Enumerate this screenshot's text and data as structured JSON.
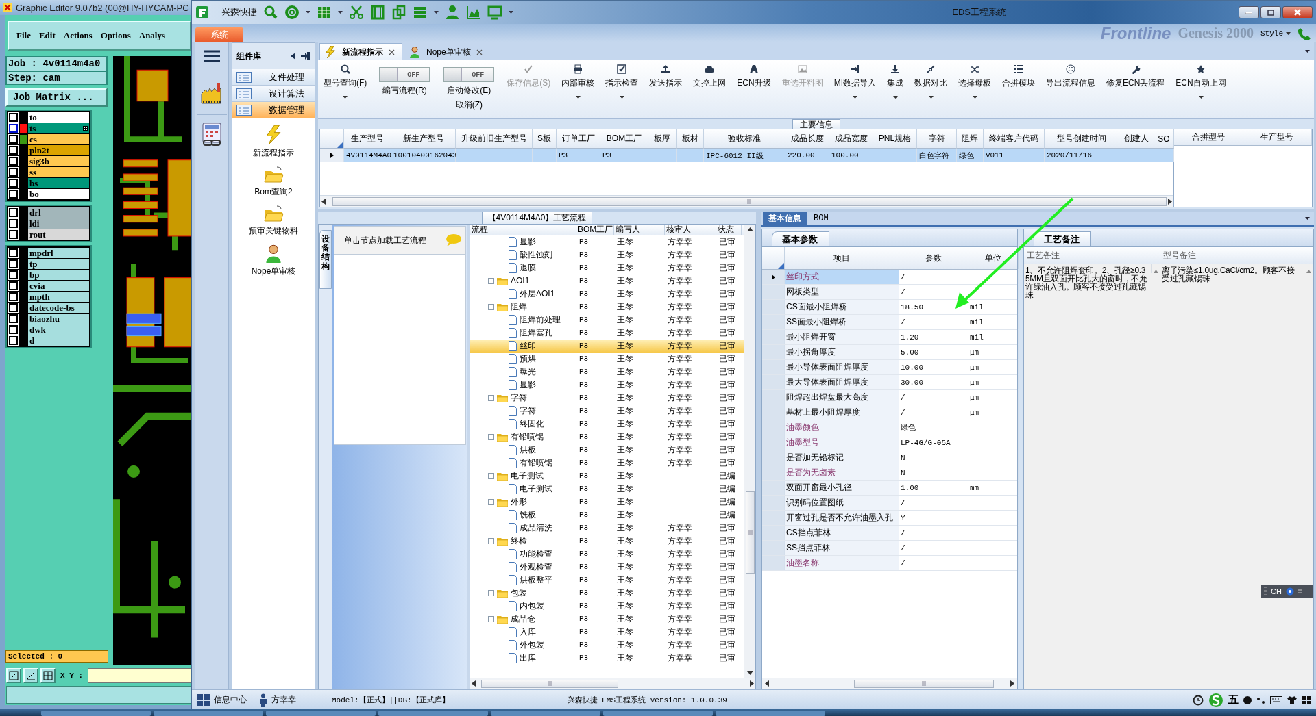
{
  "editor": {
    "title": "Graphic Editor 9.07b2 (00@HY-HYCAM-PC",
    "menu": [
      "File",
      "Edit",
      "Actions",
      "Options",
      "Analys"
    ],
    "job": "Job : 4v0114m4a0",
    "step": "Step: cam",
    "matrix_button": "Job Matrix ...",
    "layer_groups": [
      {
        "layers": [
          {
            "name": "to",
            "color": "#ffffff",
            "selected": false
          },
          {
            "name": "ts",
            "color": "#00987a",
            "swatch": {
              "color": "#ff1010"
            },
            "selected": true
          },
          {
            "name": "cs",
            "color": "#ffc850",
            "swatch": {
              "color": "#3c9a14"
            },
            "selected": false
          },
          {
            "name": "pln2t",
            "color": "#dca400",
            "selected": false
          },
          {
            "name": "sig3b",
            "color": "#ffc850",
            "selected": false
          },
          {
            "name": "ss",
            "color": "#ffc850",
            "selected": false
          },
          {
            "name": "bs",
            "color": "#00987a",
            "selected": false
          },
          {
            "name": "bo",
            "color": "#ffffff",
            "selected": false
          }
        ]
      },
      {
        "layers": [
          {
            "name": "drl",
            "color": "#a2b6ba",
            "selected": false
          },
          {
            "name": "ldi",
            "color": "#a2b6ba",
            "selected": false
          },
          {
            "name": "rout",
            "color": "#d8d8d8",
            "selected": false
          }
        ]
      },
      {
        "layers": [
          {
            "name": "mpdrl",
            "color": "#a6dede",
            "selected": false
          },
          {
            "name": "tp",
            "color": "#a6dede",
            "selected": false
          },
          {
            "name": "bp",
            "color": "#a6dede",
            "selected": false
          },
          {
            "name": "cvia",
            "color": "#a6dede",
            "selected": false
          },
          {
            "name": "mpth",
            "color": "#a6dede",
            "selected": false
          },
          {
            "name": "datecode-bs",
            "color": "#a6dede",
            "selected": false
          },
          {
            "name": "biaozhu",
            "color": "#a6dede",
            "selected": false
          },
          {
            "name": "dwk",
            "color": "#a6dede",
            "selected": false
          },
          {
            "name": "d",
            "color": "#a6dede",
            "selected": false
          }
        ]
      }
    ],
    "selected_count": "Selected : 0",
    "xy_label": "X Y :"
  },
  "app": {
    "title": "EDS工程系统",
    "quick_access": "兴森快捷",
    "ribbon_tab": "系统",
    "banner": [
      "Frontline",
      "Genesis 2000"
    ],
    "style_menu": "Style",
    "components": {
      "title": "组件库",
      "categories": [
        {
          "label": "文件处理",
          "selected": false
        },
        {
          "label": "设计算法",
          "selected": false
        },
        {
          "label": "数据管理",
          "selected": true
        }
      ],
      "tools": [
        "新流程指示",
        "Bom查询2",
        "预审关键物料",
        "Nope单审核"
      ]
    },
    "doc_tabs": [
      {
        "label": "新流程指示",
        "selected": true
      },
      {
        "label": "Nope单审核",
        "selected": false
      }
    ],
    "toolbar": [
      {
        "kind": "button",
        "label": "型号查询(F)",
        "dropdown": true,
        "disabled": false
      },
      {
        "kind": "toggle",
        "label": "编写流程(R)",
        "state_text": "OFF",
        "on": false
      },
      {
        "kind": "toggle",
        "label": "启动修改(E)",
        "sublabel": "取消(Z)",
        "state_text": "OFF",
        "on": false
      },
      {
        "kind": "button",
        "label": "保存信息(S)",
        "dropdown": false,
        "disabled": true
      },
      {
        "kind": "button",
        "label": "内部审核",
        "dropdown": true,
        "disabled": false
      },
      {
        "kind": "button",
        "label": "指示检查",
        "dropdown": true,
        "disabled": false
      },
      {
        "kind": "button",
        "label": "发送指示",
        "dropdown": false,
        "disabled": false
      },
      {
        "kind": "button",
        "label": "文控上网",
        "dropdown": false,
        "disabled": false
      },
      {
        "kind": "button",
        "label": "ECN升级",
        "dropdown": false,
        "disabled": false
      },
      {
        "kind": "button",
        "label": "重选开料图",
        "dropdown": false,
        "disabled": true
      },
      {
        "kind": "button",
        "label": "MI数据导入",
        "dropdown": true,
        "disabled": false
      },
      {
        "kind": "button",
        "label": "集成",
        "dropdown": true,
        "disabled": false
      },
      {
        "kind": "button",
        "label": "数据对比",
        "dropdown": true,
        "disabled": false
      },
      {
        "kind": "button",
        "label": "选择母板",
        "dropdown": true,
        "disabled": false
      },
      {
        "kind": "button",
        "label": "合拼模块",
        "dropdown": false,
        "disabled": false
      },
      {
        "kind": "button",
        "label": "导出流程信息",
        "dropdown": false,
        "disabled": false
      },
      {
        "kind": "button",
        "label": "修复ECN丢流程",
        "dropdown": false,
        "disabled": false
      },
      {
        "kind": "button",
        "label": "ECN自动上网",
        "dropdown": true,
        "disabled": false
      }
    ],
    "main_info": {
      "title": "主要信息",
      "columns": [
        "生产型号",
        "新生产型号",
        "升级前旧生产型号",
        "S板",
        "订单工厂",
        "BOM工厂",
        "板厚",
        "板材",
        "验收标准",
        "成品长度",
        "成品宽度",
        "PNL规格",
        "字符",
        "阻焊",
        "终端客户代码",
        "型号创建时间",
        "创建人",
        "SO"
      ],
      "rows": [
        {
          "selected": true,
          "cells": [
            "4V0114M4A0",
            "10010400162043",
            null,
            null,
            "P3",
            "P3",
            null,
            null,
            "IPC-6012 II级",
            "220.00",
            "100.00",
            null,
            "白色字符",
            "绿色",
            "V011",
            "2020/11/16",
            null,
            null
          ]
        }
      ],
      "side_columns": [
        "合拼型号",
        "生产型号"
      ]
    },
    "flow": {
      "title": "【4V0114M4A0】工艺流程",
      "side_tab": "设备结构",
      "hint": "单击节点加载工艺流程",
      "columns": [
        "流程",
        "BOM工厂",
        "编写人",
        "核审人",
        "状态"
      ],
      "nodes": [
        {
          "kind": "step",
          "label": "显影",
          "bom": "P3",
          "writer": "王琴",
          "reviewer": "方幸幸",
          "status": "已审",
          "selected": false
        },
        {
          "kind": "step",
          "label": "酸性蚀刻",
          "bom": "P3",
          "writer": "王琴",
          "reviewer": "方幸幸",
          "status": "已审",
          "selected": false
        },
        {
          "kind": "step",
          "label": "退膜",
          "bom": "P3",
          "writer": "王琴",
          "reviewer": "方幸幸",
          "status": "已审",
          "selected": false
        },
        {
          "kind": "group",
          "label": "AOI1",
          "bom": "P3",
          "writer": "王琴",
          "reviewer": "方幸幸",
          "status": "已审",
          "selected": false,
          "expanded": true,
          "children": [
            {
              "kind": "step",
              "label": "外层AOI1",
              "bom": "P3",
              "writer": "王琴",
              "reviewer": "方幸幸",
              "status": "已审",
              "selected": false
            }
          ]
        },
        {
          "kind": "group",
          "label": "阻焊",
          "bom": "P3",
          "writer": "王琴",
          "reviewer": "方幸幸",
          "status": "已审",
          "selected": false,
          "expanded": true,
          "children": [
            {
              "kind": "step",
              "label": "阻焊前处理",
              "bom": "P3",
              "writer": "王琴",
              "reviewer": "方幸幸",
              "status": "已审",
              "selected": false
            },
            {
              "kind": "step",
              "label": "阻焊塞孔",
              "bom": "P3",
              "writer": "王琴",
              "reviewer": "方幸幸",
              "status": "已审",
              "selected": false
            },
            {
              "kind": "step",
              "label": "丝印",
              "bom": "P3",
              "writer": "王琴",
              "reviewer": "方幸幸",
              "status": "已审",
              "selected": true
            },
            {
              "kind": "step",
              "label": "预烘",
              "bom": "P3",
              "writer": "王琴",
              "reviewer": "方幸幸",
              "status": "已审",
              "selected": false
            },
            {
              "kind": "step",
              "label": "曝光",
              "bom": "P3",
              "writer": "王琴",
              "reviewer": "方幸幸",
              "status": "已审",
              "selected": false
            },
            {
              "kind": "step",
              "label": "显影",
              "bom": "P3",
              "writer": "王琴",
              "reviewer": "方幸幸",
              "status": "已审",
              "selected": false
            }
          ]
        },
        {
          "kind": "group",
          "label": "字符",
          "bom": "P3",
          "writer": "王琴",
          "reviewer": "方幸幸",
          "status": "已审",
          "selected": false,
          "expanded": true,
          "children": [
            {
              "kind": "step",
              "label": "字符",
              "bom": "P3",
              "writer": "王琴",
              "reviewer": "方幸幸",
              "status": "已审",
              "selected": false
            },
            {
              "kind": "step",
              "label": "终固化",
              "bom": "P3",
              "writer": "王琴",
              "reviewer": "方幸幸",
              "status": "已审",
              "selected": false
            }
          ]
        },
        {
          "kind": "group",
          "label": "有铅喷锡",
          "bom": "P3",
          "writer": "王琴",
          "reviewer": "方幸幸",
          "status": "已审",
          "selected": false,
          "expanded": true,
          "children": [
            {
              "kind": "step",
              "label": "烘板",
              "bom": "P3",
              "writer": "王琴",
              "reviewer": "方幸幸",
              "status": "已审",
              "selected": false
            },
            {
              "kind": "step",
              "label": "有铅喷锡",
              "bom": "P3",
              "writer": "王琴",
              "reviewer": "方幸幸",
              "status": "已审",
              "selected": false
            }
          ]
        },
        {
          "kind": "group",
          "label": "电子测试",
          "bom": "P3",
          "writer": "王琴",
          "status": "已编",
          "selected": false,
          "expanded": true,
          "children": [
            {
              "kind": "step",
              "label": "电子测试",
              "bom": "P3",
              "writer": "王琴",
              "status": "已编",
              "selected": false
            }
          ]
        },
        {
          "kind": "group",
          "label": "外形",
          "bom": "P3",
          "writer": "王琴",
          "status": "已编",
          "selected": false,
          "expanded": true,
          "children": [
            {
              "kind": "step",
              "label": "铣板",
              "bom": "P3",
              "writer": "王琴",
              "status": "已编",
              "selected": false
            },
            {
              "kind": "step",
              "label": "成品清洗",
              "bom": "P3",
              "writer": "王琴",
              "reviewer": "方幸幸",
              "status": "已审",
              "selected": false
            }
          ]
        },
        {
          "kind": "group",
          "label": "终检",
          "bom": "P3",
          "writer": "王琴",
          "reviewer": "方幸幸",
          "status": "已审",
          "selected": false,
          "expanded": true,
          "children": [
            {
              "kind": "step",
              "label": "功能检查",
              "bom": "P3",
              "writer": "王琴",
              "reviewer": "方幸幸",
              "status": "已审",
              "selected": false
            },
            {
              "kind": "step",
              "label": "外观检查",
              "bom": "P3",
              "writer": "王琴",
              "reviewer": "方幸幸",
              "status": "已审",
              "selected": false
            },
            {
              "kind": "step",
              "label": "烘板整平",
              "bom": "P3",
              "writer": "王琴",
              "reviewer": "方幸幸",
              "status": "已审",
              "selected": false
            }
          ]
        },
        {
          "kind": "group",
          "label": "包装",
          "bom": "P3",
          "writer": "王琴",
          "reviewer": "方幸幸",
          "status": "已审",
          "selected": false,
          "expanded": true,
          "children": [
            {
              "kind": "step",
              "label": "内包装",
              "bom": "P3",
              "writer": "王琴",
              "reviewer": "方幸幸",
              "status": "已审",
              "selected": false
            }
          ]
        },
        {
          "kind": "group",
          "label": "成品仓",
          "bom": "P3",
          "writer": "王琴",
          "reviewer": "方幸幸",
          "status": "已审",
          "selected": false,
          "expanded": true,
          "children": [
            {
              "kind": "step",
              "label": "入库",
              "bom": "P3",
              "writer": "王琴",
              "reviewer": "方幸幸",
              "status": "已审",
              "selected": false
            },
            {
              "kind": "step",
              "label": "外包装",
              "bom": "P3",
              "writer": "王琴",
              "reviewer": "方幸幸",
              "status": "已审",
              "selected": false
            },
            {
              "kind": "step",
              "label": "出库",
              "bom": "P3",
              "writer": "王琴",
              "reviewer": "方幸幸",
              "status": "已审",
              "selected": false
            }
          ]
        }
      ]
    },
    "info": {
      "tabs": [
        {
          "label": "基本信息",
          "selected": true
        },
        {
          "label": "BOM",
          "selected": false
        }
      ],
      "params_tab": "基本参数",
      "params_columns": [
        "项目",
        "参数",
        "单位"
      ],
      "params": [
        {
          "item": "丝印方式",
          "value": "/",
          "highlighted": true,
          "selected": true
        },
        {
          "item": "网板类型",
          "value": "/",
          "highlighted": false,
          "selected": false
        },
        {
          "item": "CS面最小阻焊桥",
          "value": "18.50",
          "unit": "mil",
          "highlighted": false,
          "selected": false
        },
        {
          "item": "SS面最小阻焊桥",
          "value": "/",
          "unit": "mil",
          "highlighted": false,
          "selected": false
        },
        {
          "item": "最小阻焊开窗",
          "value": "1.20",
          "unit": "mil",
          "highlighted": false,
          "selected": false
        },
        {
          "item": "最小拐角厚度",
          "value": "5.00",
          "unit": "μm",
          "highlighted": false,
          "selected": false
        },
        {
          "item": "最小导体表面阻焊厚度",
          "value": "10.00",
          "unit": "μm",
          "highlighted": false,
          "selected": false
        },
        {
          "item": "最大导体表面阻焊厚度",
          "value": "30.00",
          "unit": "μm",
          "highlighted": false,
          "selected": false
        },
        {
          "item": "阻焊超出焊盘最大高度",
          "value": "/",
          "unit": "μm",
          "highlighted": false,
          "selected": false
        },
        {
          "item": "基材上最小阻焊厚度",
          "value": "/",
          "unit": "μm",
          "highlighted": false,
          "selected": false
        },
        {
          "item": "油墨颜色",
          "value": "绿色",
          "highlighted": true,
          "selected": false
        },
        {
          "item": "油墨型号",
          "value": "LP-4G/G-05A",
          "highlighted": true,
          "selected": false
        },
        {
          "item": "是否加无铅标记",
          "value": "N",
          "highlighted": false,
          "selected": false
        },
        {
          "item": "是否为无卤素",
          "value": "N",
          "highlighted": true,
          "selected": false
        },
        {
          "item": "双面开窗最小孔径",
          "value": "1.00",
          "unit": "mm",
          "highlighted": false,
          "selected": false
        },
        {
          "item": "识别码位置图纸",
          "value": "/",
          "highlighted": false,
          "selected": false
        },
        {
          "item": "开窗过孔是否不允许油墨入孔",
          "value": "Y",
          "highlighted": false,
          "selected": false
        },
        {
          "item": "CS挡点菲林",
          "value": "/",
          "highlighted": false,
          "selected": false
        },
        {
          "item": "SS挡点菲林",
          "value": "/",
          "highlighted": false,
          "selected": false
        },
        {
          "item": "油墨名称",
          "value": "/",
          "highlighted": true,
          "selected": false
        }
      ],
      "remarks_tab": "工艺备注",
      "remarks_columns": [
        "工艺备注",
        "型号备注"
      ],
      "remarks": [
        "1、不允许阻焊套印。2、孔径≥0.35MM且双面开比孔大的窗时，不允许绿油入孔。顾客不接受过孔藏锡珠",
        "离子污染≤1.0ug.CaCl/cm2。顾客不接受过孔藏锡珠"
      ]
    },
    "status": {
      "info_center": "信息中心",
      "user": "方幸幸",
      "model": "Model:【正式】||DB:【正式库】",
      "version": "兴森快捷 EMS工程系统 Version: 1.0.0.39"
    }
  },
  "tray": {
    "ime_mode": "五"
  },
  "lang_bar": {
    "label": "CH"
  }
}
